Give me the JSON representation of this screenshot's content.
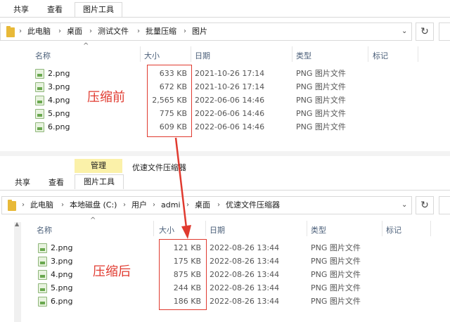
{
  "colors": {
    "annotation": "#e03a2f",
    "context_tab_bg": "#fbf1a9",
    "folder": "#e8b938",
    "header_text": "#4c607a"
  },
  "top": {
    "ribbon_tabs": [
      "共享",
      "查看"
    ],
    "active_tab": "图片工具",
    "breadcrumb": [
      "此电脑",
      "桌面",
      "测试文件",
      "批量压缩",
      "图片"
    ],
    "columns": {
      "name": "名称",
      "size": "大小",
      "date": "日期",
      "type": "类型",
      "tags": "标记"
    },
    "annotation": "压缩前",
    "files": [
      {
        "name": "2.png",
        "size": "633 KB",
        "date": "2021-10-26 17:14",
        "type": "PNG 图片文件"
      },
      {
        "name": "3.png",
        "size": "672 KB",
        "date": "2021-10-26 17:14",
        "type": "PNG 图片文件"
      },
      {
        "name": "4.png",
        "size": "2,565 KB",
        "date": "2022-06-06 14:46",
        "type": "PNG 图片文件"
      },
      {
        "name": "5.png",
        "size": "775 KB",
        "date": "2022-06-06 14:46",
        "type": "PNG 图片文件"
      },
      {
        "name": "6.png",
        "size": "609 KB",
        "date": "2022-06-06 14:46",
        "type": "PNG 图片文件"
      }
    ]
  },
  "bottom": {
    "context_tab": "管理",
    "window_title": "优速文件压缩器",
    "ribbon_tabs": [
      "共享",
      "查看"
    ],
    "active_tab": "图片工具",
    "breadcrumb": [
      "此电脑",
      "本地磁盘 (C:)",
      "用户",
      "admi",
      "桌面",
      "优速文件压缩器"
    ],
    "columns": {
      "name": "名称",
      "size": "大小",
      "date": "日期",
      "type": "类型",
      "tags": "标记"
    },
    "annotation": "压缩后",
    "files": [
      {
        "name": "2.png",
        "size": "121 KB",
        "date": "2022-08-26 13:44",
        "type": "PNG 图片文件"
      },
      {
        "name": "3.png",
        "size": "175 KB",
        "date": "2022-08-26 13:44",
        "type": "PNG 图片文件"
      },
      {
        "name": "4.png",
        "size": "875 KB",
        "date": "2022-08-26 13:44",
        "type": "PNG 图片文件"
      },
      {
        "name": "5.png",
        "size": "244 KB",
        "date": "2022-08-26 13:44",
        "type": "PNG 图片文件"
      },
      {
        "name": "6.png",
        "size": "186 KB",
        "date": "2022-08-26 13:44",
        "type": "PNG 图片文件"
      }
    ]
  }
}
